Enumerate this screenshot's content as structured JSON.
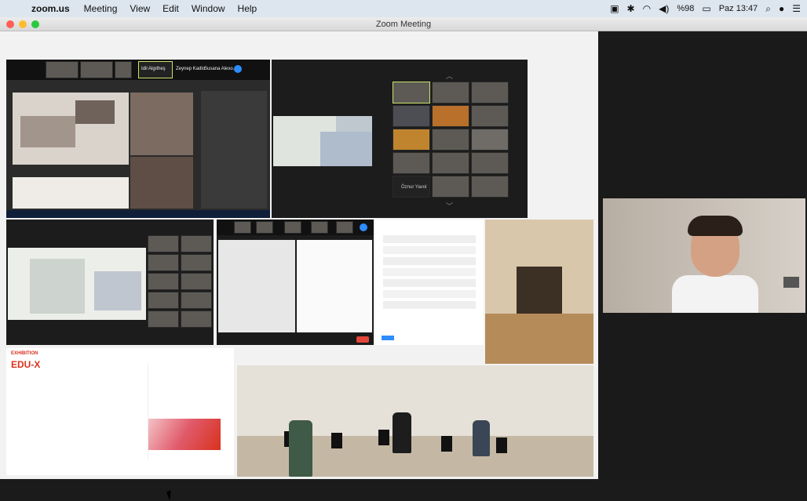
{
  "menubar": {
    "apple": "",
    "app": "zoom.us",
    "items": [
      "Meeting",
      "View",
      "Edit",
      "Window",
      "Help"
    ],
    "battery": "%98",
    "clock": "Paz 13:47"
  },
  "window": {
    "title": "Zoom Meeting"
  },
  "tiles": {
    "top_left_names": [
      "Idil Algıtheş",
      "Zeynep Kadlo",
      "Susana Alexo..."
    ],
    "gallery_name": "Öznur Yavol",
    "edu_title": "EDU-X",
    "edu_label": "EXHIBITION"
  },
  "colors": {
    "accent_red": "#d8321e",
    "active_speaker": "#c9e36a",
    "zoom_blue": "#2d8cff"
  }
}
